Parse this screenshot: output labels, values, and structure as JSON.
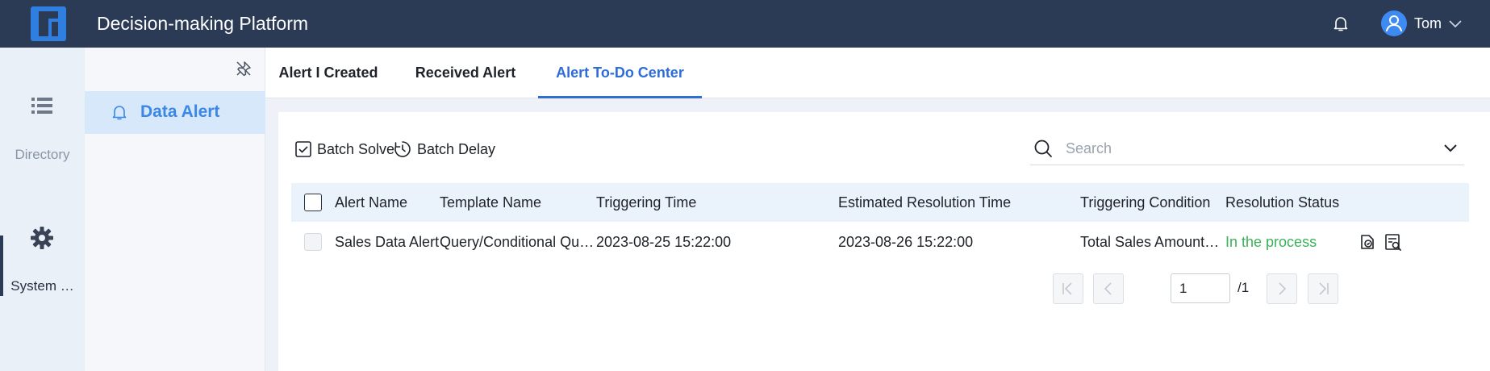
{
  "app": {
    "title": "Decision-making Platform"
  },
  "user": {
    "name": "Tom"
  },
  "rail": {
    "items": [
      {
        "label": "Directory",
        "icon": "list-icon"
      },
      {
        "label": "System …",
        "icon": "gear-icon"
      }
    ]
  },
  "subnav": {
    "item": "Data Alert"
  },
  "tabs": [
    {
      "label": "Alert I Created"
    },
    {
      "label": "Received Alert"
    },
    {
      "label": "Alert To-Do Center"
    }
  ],
  "toolbar": {
    "batch_solve": "Batch Solve",
    "batch_delay": "Batch Delay",
    "search_placeholder": "Search"
  },
  "table": {
    "columns": [
      "Alert Name",
      "Template Name",
      "Triggering Time",
      "Estimated Resolution Time",
      "Triggering Condition",
      "Resolution Status"
    ],
    "rows": [
      {
        "alert_name": "Sales Data Alert",
        "template_name": "Query/Conditional Qu…",
        "triggering_time": "2023-08-25 15:22:00",
        "estimated_resolution_time": "2023-08-26 15:22:00",
        "triggering_condition": "Total Sales Amount…",
        "resolution_status": "In the process"
      }
    ]
  },
  "pagination": {
    "current_page": "1",
    "total": "/1"
  },
  "colors": {
    "topbar": "#2b3a55",
    "accent": "#2e6cd6",
    "status_in_process": "#3cb05a",
    "subnav_active": "#d8e8fb"
  }
}
